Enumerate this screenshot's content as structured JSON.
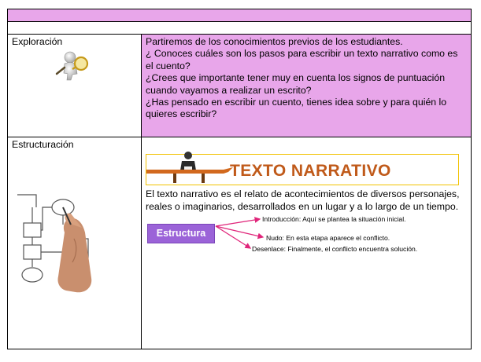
{
  "rows": [
    {
      "label": "Exploración",
      "paragraphs": [
        "Partiremos de los conocimientos previos de los estudiantes.",
        "¿  Conoces cuáles son los pasos para escribir un texto narrativo como es el cuento?",
        "¿Crees que importante tener muy en cuenta los signos de puntuación cuando vayamos a realizar un escrito?",
        "¿Has pensado en escribir un cuento, tienes idea sobre y para quién lo quieres escribir?"
      ],
      "icon": "magnifier-figure-icon"
    },
    {
      "label": "Estructuración",
      "banner_title": "TEXTO NARRATIVO",
      "definition": "El texto narrativo es el relato de acontecimientos de diversos personajes, reales o imaginarios, desarrollados en un lugar y a lo largo de un tiempo.",
      "structure_label": "Estructura",
      "parts": [
        "Introducción: Aquí se plantea la situación inicial.",
        "Nudo: En esta etapa aparece el conflicto.",
        "Desenlace: Finalmente, el conflicto encuentra solución."
      ],
      "icon": "hand-drawing-flowchart-icon",
      "banner_icon": "person-at-desk-icon"
    }
  ],
  "colors": {
    "header": "#e8a6ea",
    "highlight": "#e8a6ea",
    "structure_button": "#9b63d8",
    "arrow": "#e0257a",
    "banner_border": "#f2c200",
    "banner_text": "#c05a1a"
  }
}
